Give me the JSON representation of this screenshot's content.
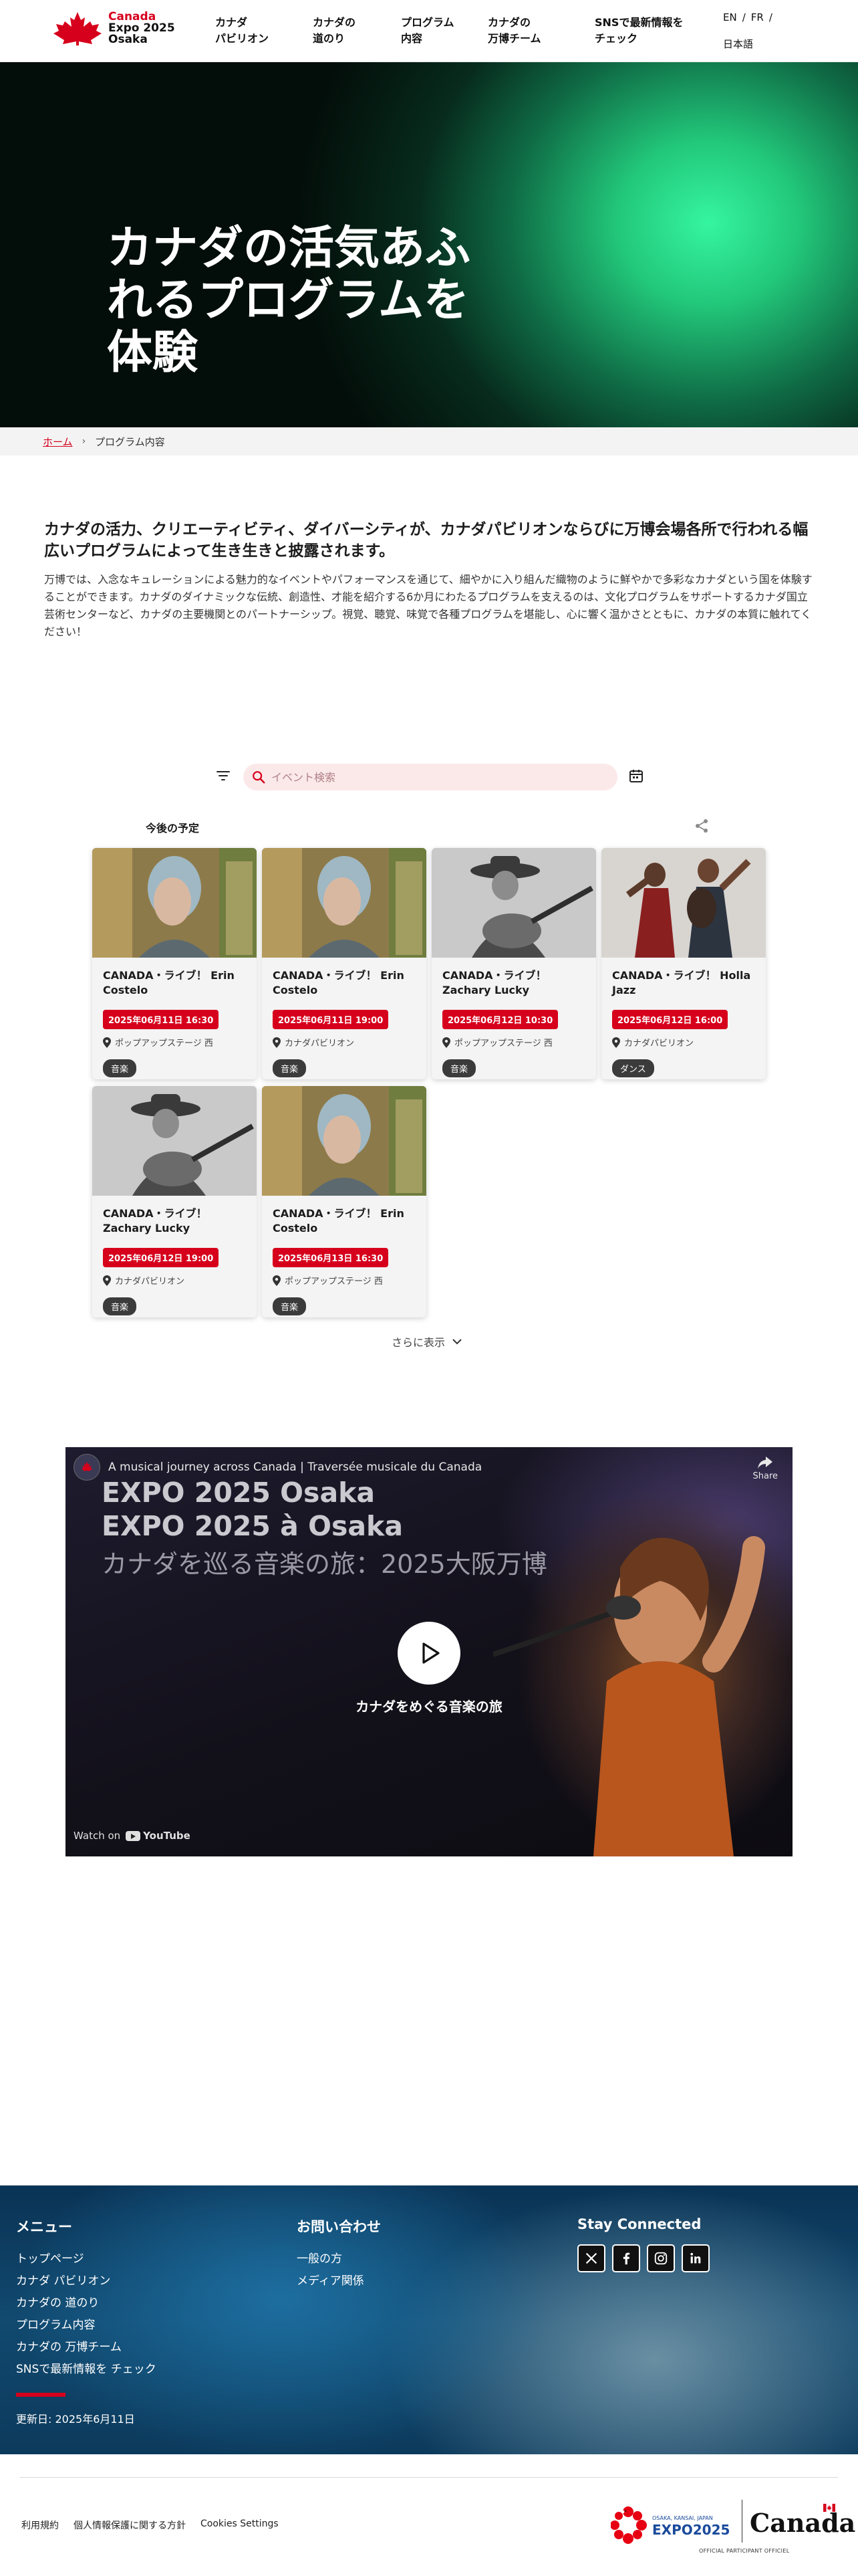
{
  "header": {
    "logo": {
      "line1": "Canada",
      "line2": "Expo 2025",
      "line3": "Osaka"
    },
    "nav": [
      {
        "label": "カナダ\nパビリオン"
      },
      {
        "label": "カナダの\n道のり"
      },
      {
        "label": "プログラム\n内容"
      },
      {
        "label": "カナダの\n万博チーム"
      },
      {
        "label": "SNSで最新情報を\nチェック"
      }
    ],
    "lang": {
      "en": "EN",
      "fr": "FR",
      "sep": "/",
      "jp": "日本語"
    }
  },
  "hero": {
    "title": "カナダの活気あふ\nれるプログラムを\n体験"
  },
  "breadcrumb": {
    "home": "ホーム",
    "current": "プログラム内容"
  },
  "intro": {
    "lead": "カナダの活力、クリエーティビティ、ダイバーシティが、カナダパビリオンならびに万博会場各所で行われる幅広いプログラムによって生き生きと披露されます。",
    "body": "万博では、入念なキュレーションによる魅力的なイベントやパフォーマンスを通じて、細やかに入り組んだ織物のように鮮やかで多彩なカナダという国を体験することができます。カナダのダイナミックな伝統、創造性、才能を紹介する6か月にわたるプログラムを支えるのは、文化プログラムをサポートするカナダ国立芸術センターなど、カナダの主要機関とのパートナーシップ。視覚、聴覚、味覚で各種プログラムを堪能し、心に響く温かさとともに、カナダの本質に触れてください！"
  },
  "search": {
    "placeholder": "イベント検索"
  },
  "events": {
    "title": "今後の予定",
    "cards": [
      {
        "title": "CANADA・ライブ！ Erin Costelo",
        "date": "2025年06月11日 16:30",
        "location": "ポップアップステージ 西",
        "tag": "音楽",
        "photo": "erin"
      },
      {
        "title": "CANADA・ライブ！ Erin Costelo",
        "date": "2025年06月11日 19:00",
        "location": "カナダパビリオン",
        "tag": "音楽",
        "photo": "erin"
      },
      {
        "title": "CANADA・ライブ！ Zachary Lucky",
        "date": "2025年06月12日 10:30",
        "location": "ポップアップステージ 西",
        "tag": "音楽",
        "photo": "zachary"
      },
      {
        "title": "CANADA・ライブ！ Holla Jazz",
        "date": "2025年06月12日 16:00",
        "location": "カナダパビリオン",
        "tag": "ダンス",
        "photo": "holla"
      },
      {
        "title": "CANADA・ライブ！ Zachary Lucky",
        "date": "2025年06月12日 19:00",
        "location": "カナダパビリオン",
        "tag": "音楽",
        "photo": "zachary"
      },
      {
        "title": "CANADA・ライブ！ Erin Costelo",
        "date": "2025年06月13日 16:30",
        "location": "ポップアップステージ 西",
        "tag": "音楽",
        "photo": "erin"
      }
    ],
    "more": "さらに表示"
  },
  "video": {
    "channel_title": "A musical journey across Canada | Traversée musicale du Canada",
    "share": "Share",
    "line1": "EXPO 2025 Osaka",
    "line2": "EXPO 2025 à Osaka",
    "line3": "カナダを巡る音楽の旅：2025大阪万博",
    "caption": "カナダをめぐる音楽の旅",
    "watch_on": "Watch on",
    "youtube": "YouTube"
  },
  "footer": {
    "menu_title": "メニュー",
    "menu": [
      "トップページ",
      "カナダ パビリオン",
      "カナダの 道のり",
      "プログラム内容",
      "カナダの 万博チーム",
      "SNSで最新情報を チェック"
    ],
    "contact_title": "お問い合わせ",
    "contact": [
      "一般の方",
      "メディア関係"
    ],
    "social_title": "Stay Connected",
    "updated": "更新日: 2025年6月11日"
  },
  "bottom": {
    "links": [
      "利用規約",
      "個人情報保護に関する方針",
      "Cookies Settings"
    ],
    "expo_small": "OSAKA, KANSAI, JAPAN",
    "expo_name": "EXPO2025",
    "canada_word": "Canada",
    "official": "OFFICIAL PARTICIPANT OFFICIEL"
  },
  "colors": {
    "accent": "#d6001c",
    "hero_green": "#35f5a0",
    "footer_blue": "#11496f"
  }
}
